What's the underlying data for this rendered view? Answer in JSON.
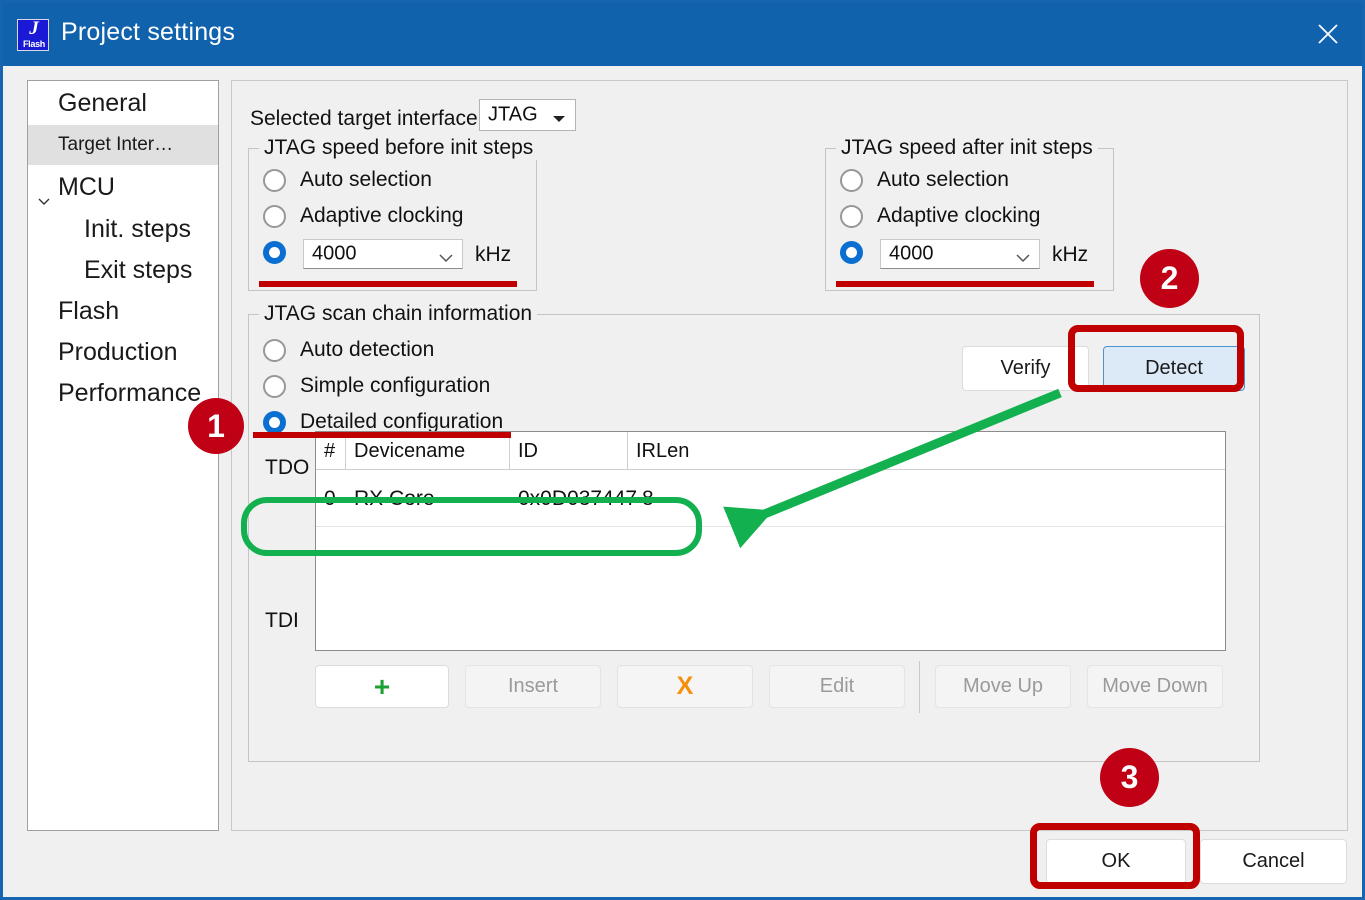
{
  "window": {
    "title": "Project settings",
    "icon_name": "jflash-icon",
    "icon_line1": "J",
    "icon_line2": "Flash",
    "close_label": "Close"
  },
  "sidebar": {
    "items": [
      {
        "label": "General",
        "level": 0,
        "selected": false,
        "chevron": false,
        "small": false
      },
      {
        "label": "Target Inter…",
        "level": 0,
        "selected": true,
        "chevron": false,
        "small": true
      },
      {
        "label": "MCU",
        "level": 0,
        "selected": false,
        "chevron": true,
        "small": false
      },
      {
        "label": "Init. steps",
        "level": 1,
        "selected": false,
        "chevron": false,
        "small": false
      },
      {
        "label": "Exit steps",
        "level": 1,
        "selected": false,
        "chevron": false,
        "small": false
      },
      {
        "label": "Flash",
        "level": 0,
        "selected": false,
        "chevron": false,
        "small": false
      },
      {
        "label": "Production",
        "level": 0,
        "selected": false,
        "chevron": false,
        "small": false
      },
      {
        "label": "Performance",
        "level": 0,
        "selected": false,
        "chevron": false,
        "small": false
      }
    ]
  },
  "target_interface": {
    "label": "Selected target interface:",
    "value": "JTAG"
  },
  "speed_before": {
    "title": "JTAG speed before init steps",
    "options": [
      {
        "label": "Auto selection",
        "checked": false
      },
      {
        "label": "Adaptive clocking",
        "checked": false
      }
    ],
    "fixed_checked": true,
    "fixed_value": "4000",
    "unit": "kHz"
  },
  "speed_after": {
    "title": "JTAG speed after init steps",
    "options": [
      {
        "label": "Auto selection",
        "checked": false
      },
      {
        "label": "Adaptive clocking",
        "checked": false
      }
    ],
    "fixed_checked": true,
    "fixed_value": "4000",
    "unit": "kHz"
  },
  "scan_chain": {
    "title": "JTAG scan chain information",
    "options": [
      {
        "label": "Auto detection",
        "checked": false
      },
      {
        "label": "Simple configuration",
        "checked": false
      },
      {
        "label": "Detailed configuration",
        "checked": true
      }
    ],
    "verify_label": "Verify",
    "detect_label": "Detect",
    "tdo_label": "TDO",
    "tdi_label": "TDI",
    "columns": [
      "#",
      "Devicename",
      "ID",
      "IRLen"
    ],
    "rows": [
      {
        "index": "0",
        "devicename": "RX Core",
        "id": "0x0D037447",
        "irlen": "8"
      }
    ],
    "toolbar": [
      {
        "label": "+",
        "kind": "add",
        "disabled": false
      },
      {
        "label": "Insert",
        "kind": "insert",
        "disabled": true
      },
      {
        "label": "X",
        "kind": "remove",
        "disabled": false
      },
      {
        "label": "Edit",
        "kind": "edit",
        "disabled": true
      },
      {
        "label": "Move Up",
        "kind": "move-up",
        "disabled": true
      },
      {
        "label": "Move Down",
        "kind": "move-down",
        "disabled": true
      }
    ]
  },
  "footer": {
    "ok_label": "OK",
    "cancel_label": "Cancel"
  },
  "annotations": {
    "badges": [
      {
        "number": "1"
      },
      {
        "number": "2"
      },
      {
        "number": "3"
      }
    ],
    "highlight_color": "#c00000",
    "badge_color": "#c00014",
    "arrow_color": "#12b04e"
  }
}
